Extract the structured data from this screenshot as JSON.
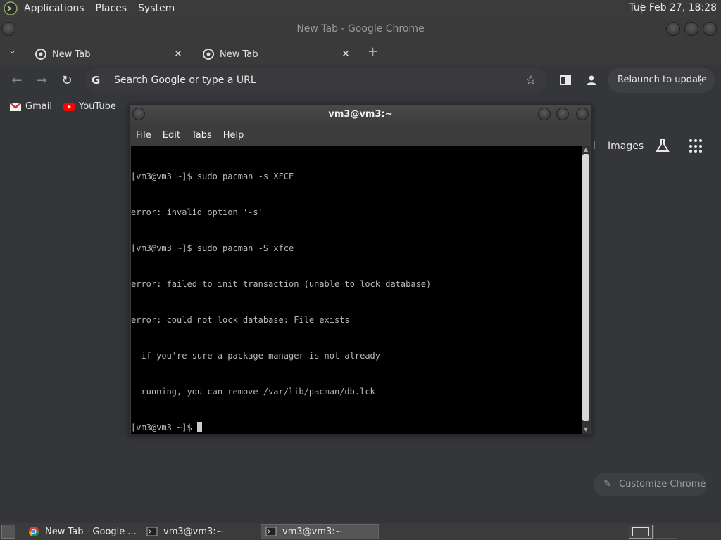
{
  "top_panel": {
    "menus": [
      "Applications",
      "Places",
      "System"
    ],
    "clock": "Tue Feb 27, 18:28"
  },
  "chrome": {
    "window_title": "New Tab - Google Chrome",
    "tabs": [
      {
        "label": "New Tab",
        "active": true
      },
      {
        "label": "New Tab",
        "active": false
      }
    ],
    "omnibox_placeholder": "Search Google or type a URL",
    "relaunch_label": "Relaunch to update",
    "bookmarks": [
      {
        "label": "Gmail",
        "icon": "gmail-icon"
      },
      {
        "label": "YouTube",
        "icon": "youtube-icon"
      }
    ],
    "ntp": {
      "images_link": "Images",
      "gmail_link_partial": "il",
      "customize_label": "Customize Chrome"
    }
  },
  "terminal": {
    "title": "vm3@vm3:~",
    "menus": [
      "File",
      "Edit",
      "Tabs",
      "Help"
    ],
    "lines": [
      "[vm3@vm3 ~]$ sudo pacman -s XFCE",
      "error: invalid option '-s'",
      "[vm3@vm3 ~]$ sudo pacman -S xfce",
      "error: failed to init transaction (unable to lock database)",
      "error: could not lock database: File exists",
      "  if you're sure a package manager is not already",
      "  running, you can remove /var/lib/pacman/db.lck",
      "[vm3@vm3 ~]$ "
    ]
  },
  "taskbar": {
    "tasks": [
      {
        "label": "New Tab - Google ...",
        "icon": "chrome-icon",
        "active": false
      },
      {
        "label": "vm3@vm3:~",
        "icon": "terminal-icon",
        "active": false
      },
      {
        "label": "vm3@vm3:~",
        "icon": "terminal-icon",
        "active": true
      }
    ]
  },
  "colors": {
    "chrome_bg": "#35363a",
    "terminal_bg": "#000000",
    "panel_bg": "#3b3b3b"
  }
}
